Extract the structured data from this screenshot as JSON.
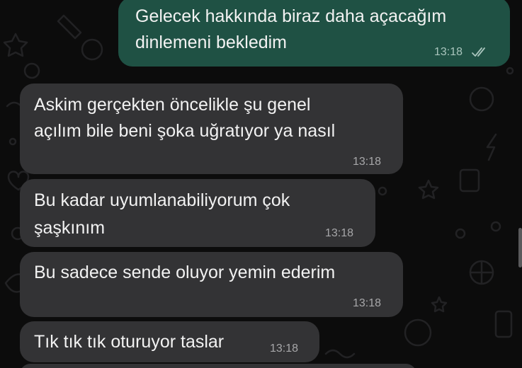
{
  "messages": [
    {
      "direction": "outgoing",
      "lines": [
        "Gelecek hakkında biraz daha açacağım",
        "dinlemeni bekledim"
      ],
      "time": "13:18",
      "status_icon": "double-check-icon"
    },
    {
      "direction": "incoming",
      "lines": [
        "Askim gerçekten öncelikle şu genel",
        "açılım bile beni şoka uğratıyor ya nasıl"
      ],
      "time": "13:18"
    },
    {
      "direction": "incoming",
      "lines": [
        "Bu kadar uyumlanabiliyorum çok",
        "şaşkınım"
      ],
      "time": "13:18"
    },
    {
      "direction": "incoming",
      "lines": [
        "Bu sadece sende oluyor yemin ederim"
      ],
      "time": "13:18"
    },
    {
      "direction": "incoming",
      "lines": [
        "Tık tık tık oturuyor taslar"
      ],
      "time": "13:18"
    }
  ],
  "colors": {
    "background": "#0c0c0c",
    "outgoing_bubble": "#1f5144",
    "incoming_bubble": "#333335",
    "text": "#f2f2f2",
    "timestamp": "#a7a7a9",
    "read_ticks": "#a9c5bd"
  }
}
